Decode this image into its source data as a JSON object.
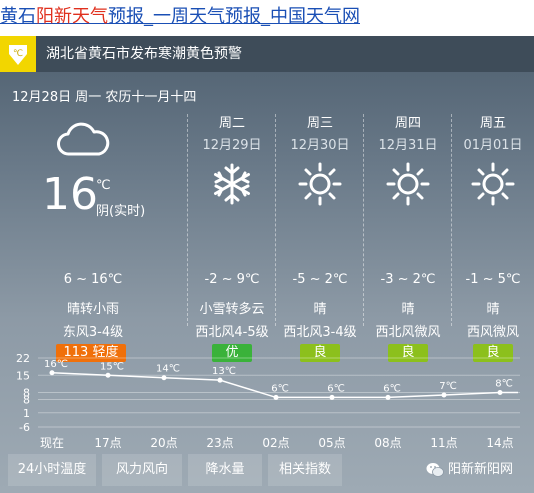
{
  "title": {
    "part1": "黄石",
    "part2": "阳新天气",
    "part3": "预报_一周天气预报_中国天气网"
  },
  "alert": {
    "text": "湖北省黄石市发布寒潮黄色预警",
    "icon": "cold-wave-warning-icon",
    "color": "#f2d600"
  },
  "date": "12月28日 周一 农历十一月十四",
  "today": {
    "icon": "cloudy-icon",
    "temp": "16",
    "unit": "℃",
    "label": "阴(实时)",
    "range": "6 ~ 16℃",
    "weather": "晴转小雨",
    "wind": "东风3-4级",
    "aqi_value": "113",
    "aqi_level": "轻度",
    "aqi_color": "#f0700a"
  },
  "days": [
    {
      "weekday": "周二",
      "date": "12月29日",
      "icon": "snow-icon",
      "range": "-2 ~ 9℃",
      "weather": "小雪转多云",
      "wind": "西北风4-5级",
      "aqi": "优",
      "aqi_color": "#3ab23a"
    },
    {
      "weekday": "周三",
      "date": "12月30日",
      "icon": "sun-icon",
      "range": "-5 ~ 2℃",
      "weather": "晴",
      "wind": "西北风3-4级",
      "aqi": "良",
      "aqi_color": "#8cc01c"
    },
    {
      "weekday": "周四",
      "date": "12月31日",
      "icon": "sun-icon",
      "range": "-3 ~ 2℃",
      "weather": "晴",
      "wind": "西北风微风",
      "aqi": "良",
      "aqi_color": "#8cc01c"
    },
    {
      "weekday": "周五",
      "date": "01月01日",
      "icon": "sun-icon",
      "range": "-1 ~ 5℃",
      "weather": "晴",
      "wind": "西风微风",
      "aqi": "良",
      "aqi_color": "#8cc01c"
    }
  ],
  "chart_data": {
    "type": "line",
    "x": [
      "现在",
      "17点",
      "20点",
      "23点",
      "02点",
      "05点",
      "08点",
      "11点",
      "14点"
    ],
    "values": [
      16,
      15,
      14,
      13,
      6,
      6,
      6,
      7,
      8
    ],
    "labels": [
      "16℃",
      "15℃",
      "14℃",
      "13℃",
      "6℃",
      "6℃",
      "6℃",
      "7℃",
      "8℃"
    ],
    "yticks": [
      22,
      15,
      8,
      8,
      1,
      -6
    ],
    "ytick_labels": [
      "22",
      "15",
      "8",
      "8",
      "1",
      "-6"
    ],
    "ylim": [
      -6,
      22
    ],
    "grid": true
  },
  "tabs": [
    "24小时温度",
    "风力风向",
    "降水量",
    "相关指数"
  ],
  "brand": "阳新新阳网"
}
